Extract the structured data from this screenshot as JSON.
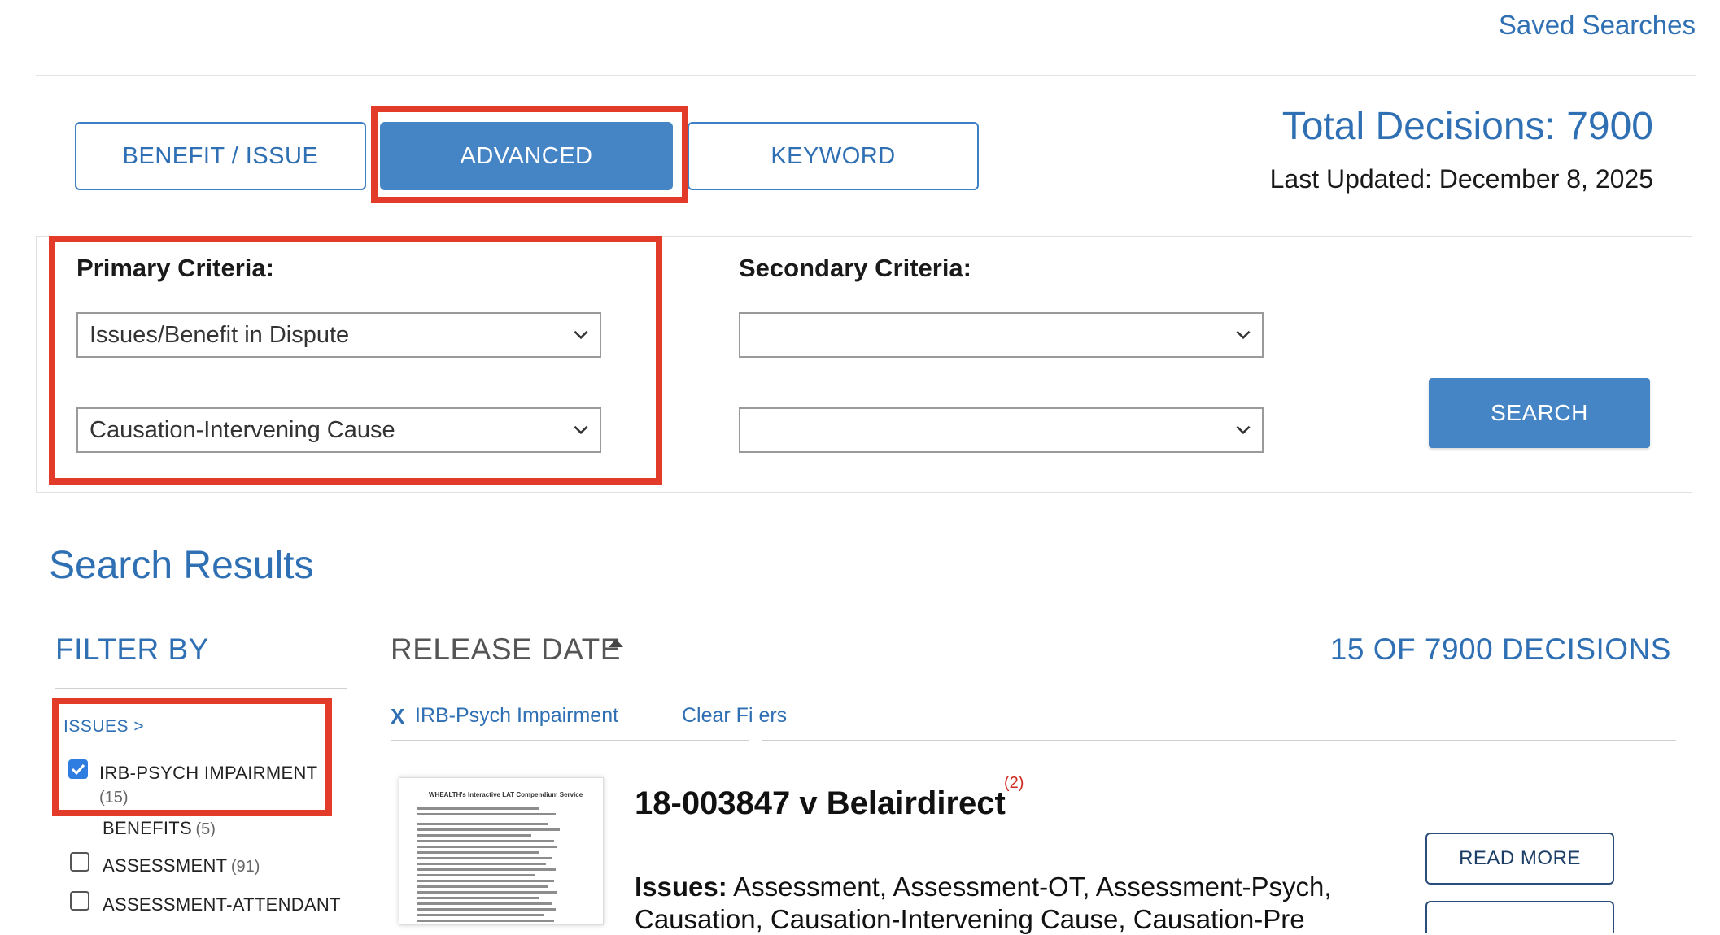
{
  "header": {
    "saved_searches": "Saved Searches"
  },
  "tabs": [
    {
      "label": "BENEFIT / ISSUE"
    },
    {
      "label": "ADVANCED",
      "active": true
    },
    {
      "label": "KEYWORD"
    }
  ],
  "summary": {
    "total": "Total Decisions: 7900",
    "updated": "Last Updated: December 8, 2025"
  },
  "criteria": {
    "primary_label": "Primary Criteria:",
    "secondary_label": "Secondary Criteria:",
    "primary_select_1": "Issues/Benefit in Dispute",
    "primary_select_2": "Causation-Intervening Cause",
    "secondary_select_1": "",
    "secondary_select_2": "",
    "search_button": "SEARCH"
  },
  "results": {
    "title": "Search Results",
    "filter_by": "FILTER BY",
    "sort_label": "RELEASE DATE",
    "count_label": "15 OF 7900 DECISIONS",
    "active_filter": "IRB-Psych Impairment",
    "active_filter_remove": "X",
    "clear_filters": "Clear Fi ers"
  },
  "filters": {
    "issues_heading": "ISSUES >",
    "items": [
      {
        "label": "IRB-PSYCH IMPAIRMENT",
        "count": "(15)",
        "checked": true
      },
      {
        "label": "BENEFITS",
        "count": "(5)",
        "checked": null
      },
      {
        "label": "ASSESSMENT",
        "count": "(91)",
        "checked": false
      },
      {
        "label": "ASSESSMENT-ATTENDANT",
        "count": "",
        "checked": false
      }
    ]
  },
  "decision": {
    "title": "18-003847 v Belairdirect",
    "superscript": "(2)",
    "issues_label": "Issues:",
    "issues_text": "Assessment, Assessment-OT, Assessment-Psych,",
    "issues_text_2": "Causation, Causation-Intervening Cause, Causation-Pre",
    "read_more": "READ MORE",
    "thumbnail_heading": "WHEALTH's Interactive LAT Compendium Service"
  },
  "colors": {
    "accent": "#2f6fb3",
    "button_fill": "#4585c6",
    "highlight": "#e23b2a"
  }
}
